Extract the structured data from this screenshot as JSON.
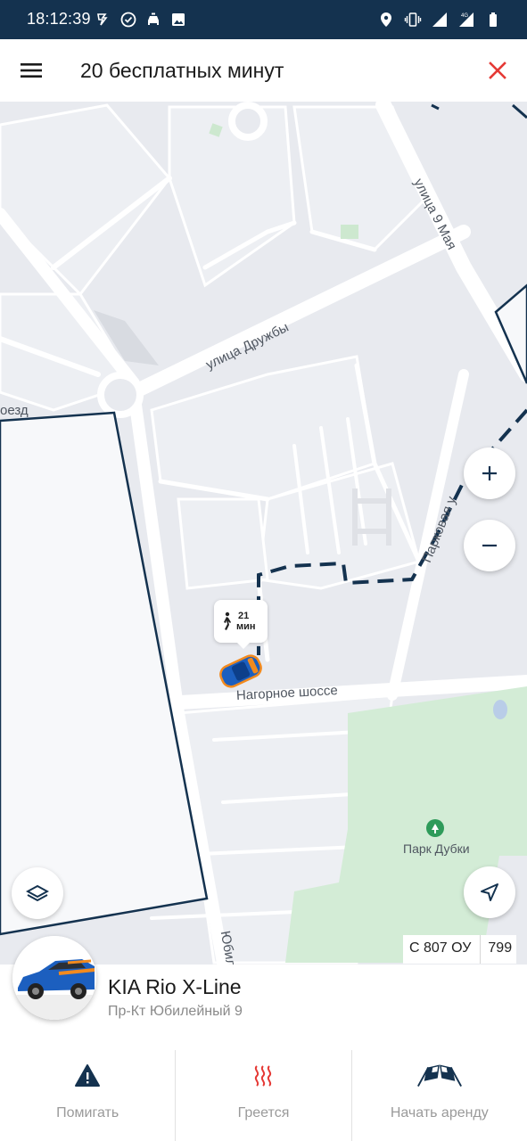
{
  "status_bar": {
    "time": "18:12:39",
    "network": "4G",
    "left_icons": [
      "taxi-app-icon",
      "check-circle-icon",
      "car-icon",
      "image-icon"
    ],
    "right_icons": [
      "location-pin-icon",
      "vibrate-icon",
      "signal-icon",
      "signal-4g-icon",
      "battery-icon"
    ]
  },
  "header": {
    "title": "20 бесплатных минут",
    "menu_icon": "hamburger-icon",
    "close_icon": "close-icon",
    "close_color": "#e53935"
  },
  "map": {
    "streets": {
      "druzhby": "улица Дружбы",
      "may9": "улица 9 Мая",
      "nagornoe": "Нагорное шоссе",
      "parkovaya": "Парковая у",
      "proezd": "оезд",
      "yubileyny": "Юбилейн"
    },
    "park": "Парк Дубки",
    "walk_time": "21",
    "walk_unit": "мин",
    "zoom_in": "+",
    "zoom_out": "−",
    "colors": {
      "zone_border": "#14324f",
      "route": "#14324f",
      "park": "#d3ecd6",
      "road": "#ffffff",
      "car_body": "#1c5fbf",
      "car_accent": "#f28a1e"
    }
  },
  "plate": {
    "number": "С 807 ОУ",
    "region": "799"
  },
  "car": {
    "name": "KIA Rio X-Line",
    "address": "Пр-Кт Юбилейный 9"
  },
  "actions": [
    {
      "label": "Помигать",
      "icon": "warning-triangle-icon",
      "color": "#14324f"
    },
    {
      "label": "Греется",
      "icon": "heating-icon",
      "color": "#e53935"
    },
    {
      "label": "Начать аренду",
      "icon": "checkered-flags-icon",
      "color": "#14324f"
    }
  ]
}
